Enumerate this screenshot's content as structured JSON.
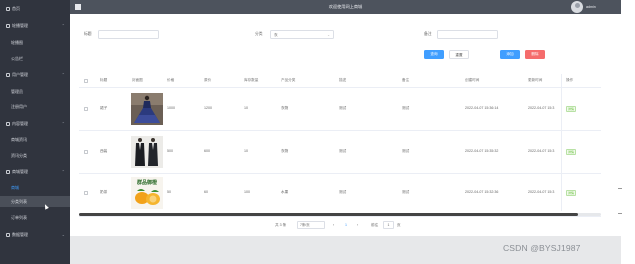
{
  "topbar": {
    "title": "欢迎使用网上商城",
    "user": "admin"
  },
  "sidebar": {
    "items": [
      {
        "label": "首页",
        "kind": "main",
        "expanded": false
      },
      {
        "label": "轮播管理",
        "kind": "main",
        "expanded": true
      },
      {
        "label": "轮播图",
        "kind": "sub"
      },
      {
        "label": "公告栏",
        "kind": "sub"
      },
      {
        "label": "用户管理",
        "kind": "main",
        "expanded": true
      },
      {
        "label": "管理员",
        "kind": "sub"
      },
      {
        "label": "注册用户",
        "kind": "sub"
      },
      {
        "label": "内容管理",
        "kind": "main",
        "expanded": true
      },
      {
        "label": "商城资讯",
        "kind": "sub"
      },
      {
        "label": "资讯分类",
        "kind": "sub"
      },
      {
        "label": "商城管理",
        "kind": "main",
        "expanded": true
      },
      {
        "label": "商城",
        "kind": "sub",
        "highlight": true
      },
      {
        "label": "分类列表",
        "kind": "sub",
        "active": true
      },
      {
        "label": "订单列表",
        "kind": "sub"
      },
      {
        "label": "数据管理",
        "kind": "main",
        "expanded": false
      }
    ]
  },
  "search": {
    "title_label": "标题",
    "title_value": "",
    "category_label": "分类",
    "category_value": "衣",
    "remark_label": "备注",
    "remark_value": "",
    "search_button": "查询",
    "reset_button": "重置",
    "add_button": "添加",
    "delete_button": "删除"
  },
  "table": {
    "headers": [
      "标题",
      "封面图",
      "价格",
      "原价",
      "库存数量",
      "产品分类",
      "描述",
      "备注",
      "创建时间",
      "更新时间",
      "操作"
    ],
    "rows": [
      {
        "title": "裙子",
        "price": "1000",
        "original": "1200",
        "stock": "10",
        "category": "衣物",
        "desc": "测试",
        "remark": "测试",
        "created": "2022-04-07 15:36:14",
        "updated": "2022-04-07 15:3",
        "action": "详情"
      },
      {
        "title": "西装",
        "price": "500",
        "original": "600",
        "stock": "10",
        "category": "衣物",
        "desc": "测试",
        "remark": "测试",
        "created": "2022-04-07 15:35:32",
        "updated": "2022-04-07 15:3",
        "action": "详情"
      },
      {
        "title": "奶茶",
        "price": "50",
        "original": "60",
        "stock": "100",
        "category": "水果",
        "desc": "测试",
        "remark": "测试",
        "created": "2022-04-07 15:32:36",
        "updated": "2022-04-07 15:3",
        "action": "详情"
      }
    ],
    "thumb_banner_text": "群品御橙"
  },
  "pagination": {
    "total": "共 3 条",
    "page_size": "7条/页",
    "prev": "‹",
    "current": "1",
    "next": "›",
    "goto_label": "前往",
    "goto_value": "1",
    "page_unit": "页"
  },
  "watermark": "CSDN @BYSJ1987",
  "colors": {
    "sidebar_bg": "#30343e",
    "topbar_bg": "#4d535d",
    "primary": "#409eff",
    "danger": "#f56c6c",
    "success": "#67c23a"
  }
}
